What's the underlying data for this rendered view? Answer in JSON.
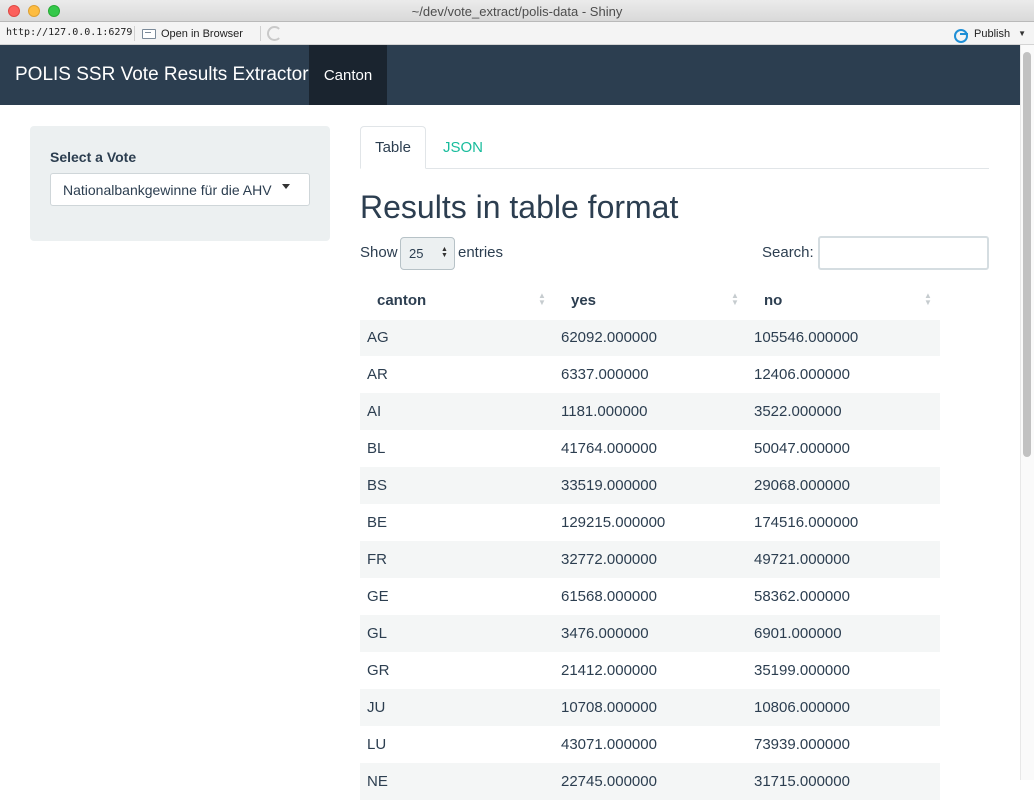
{
  "window": {
    "title": "~/dev/vote_extract/polis-data - Shiny"
  },
  "toolbar": {
    "url": "http://127.0.0.1:6279",
    "open_browser_label": "Open in Browser",
    "publish_label": "Publish"
  },
  "navbar": {
    "brand": "POLIS SSR Vote Results Extractor",
    "active_tab": "Canton"
  },
  "sidebar": {
    "label": "Select a Vote",
    "selected_vote": "Nationalbankgewinne für die AHV"
  },
  "tabs": [
    {
      "label": "Table",
      "active": true
    },
    {
      "label": "JSON",
      "active": false
    }
  ],
  "heading": "Results in table format",
  "length_control": {
    "show_label": "Show",
    "value": "25",
    "entries_label": "entries"
  },
  "search": {
    "label": "Search:",
    "value": ""
  },
  "table": {
    "columns": [
      "canton",
      "yes",
      "no"
    ],
    "rows": [
      [
        "AG",
        "62092.000000",
        "105546.000000"
      ],
      [
        "AR",
        "6337.000000",
        "12406.000000"
      ],
      [
        "AI",
        "1181.000000",
        "3522.000000"
      ],
      [
        "BL",
        "41764.000000",
        "50047.000000"
      ],
      [
        "BS",
        "33519.000000",
        "29068.000000"
      ],
      [
        "BE",
        "129215.000000",
        "174516.000000"
      ],
      [
        "FR",
        "32772.000000",
        "49721.000000"
      ],
      [
        "GE",
        "61568.000000",
        "58362.000000"
      ],
      [
        "GL",
        "3476.000000",
        "6901.000000"
      ],
      [
        "GR",
        "21412.000000",
        "35199.000000"
      ],
      [
        "JU",
        "10708.000000",
        "10806.000000"
      ],
      [
        "LU",
        "43071.000000",
        "73939.000000"
      ],
      [
        "NE",
        "22745.000000",
        "31715.000000"
      ]
    ]
  },
  "colors": {
    "navbar": "#2c3e50",
    "navbar_active": "#1a242f",
    "link": "#18bc9c",
    "text": "#2c3e50",
    "stripe": "#f4f6f6"
  }
}
